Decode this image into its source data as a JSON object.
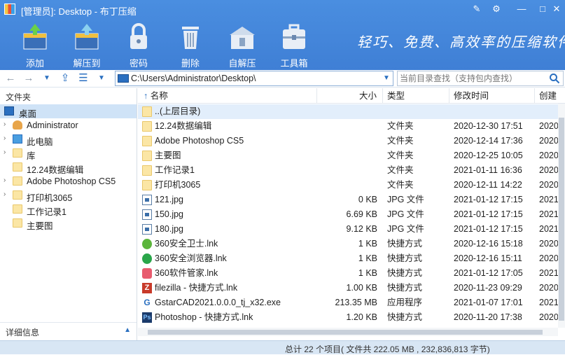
{
  "window": {
    "title": "[管理员]: Desktop - 布丁压缩"
  },
  "toolbar": {
    "tools": [
      {
        "label": "添加",
        "icon": "add-archive-icon"
      },
      {
        "label": "解压到",
        "icon": "extract-archive-icon"
      },
      {
        "label": "密码",
        "icon": "lock-icon"
      },
      {
        "label": "删除",
        "icon": "trash-icon"
      },
      {
        "label": "自解压",
        "icon": "self-extract-icon"
      },
      {
        "label": "工具箱",
        "icon": "toolbox-icon"
      }
    ],
    "slogan": "轻巧、免费、高效率的压缩软件"
  },
  "navigation": {
    "path": "C:\\Users\\Administrator\\Desktop\\",
    "search_placeholder": "当前目录查找（支持包内查找）"
  },
  "sidebar": {
    "header": "文件夹",
    "items": [
      {
        "label": "桌面",
        "selected": true,
        "expandable": false
      },
      {
        "label": "Administrator",
        "expandable": true
      },
      {
        "label": "此电脑",
        "expandable": true
      },
      {
        "label": "库",
        "expandable": true
      },
      {
        "label": "12.24数据编辑",
        "expandable": false
      },
      {
        "label": "Adobe Photoshop CS5",
        "expandable": true
      },
      {
        "label": "打印机3065",
        "expandable": true
      },
      {
        "label": "工作记录1",
        "expandable": false
      },
      {
        "label": "主要图",
        "expandable": false
      }
    ],
    "footer": "详细信息"
  },
  "file_list": {
    "columns": {
      "name": "名称",
      "size": "大小",
      "type": "类型",
      "modified": "修改时间",
      "created": "创建"
    },
    "rows": [
      {
        "name": "..(上层目录)",
        "size": "",
        "type": "",
        "modified": "",
        "created": "",
        "icon": "folder"
      },
      {
        "name": "12.24数据编辑",
        "size": "",
        "type": "文件夹",
        "modified": "2020-12-30 17:51",
        "created": "2020",
        "icon": "folder"
      },
      {
        "name": "Adobe Photoshop CS5",
        "size": "",
        "type": "文件夹",
        "modified": "2020-12-14 17:36",
        "created": "2020",
        "icon": "folder"
      },
      {
        "name": "主要图",
        "size": "",
        "type": "文件夹",
        "modified": "2020-12-25 10:05",
        "created": "2020",
        "icon": "folder"
      },
      {
        "name": "工作记录1",
        "size": "",
        "type": "文件夹",
        "modified": "2021-01-11 16:36",
        "created": "2020",
        "icon": "folder"
      },
      {
        "name": "打印机3065",
        "size": "",
        "type": "文件夹",
        "modified": "2020-12-11 14:22",
        "created": "2020",
        "icon": "folder"
      },
      {
        "name": "121.jpg",
        "size": "0 KB",
        "type": "JPG 文件",
        "modified": "2021-01-12 17:15",
        "created": "2021",
        "icon": "doc"
      },
      {
        "name": "150.jpg",
        "size": "6.69 KB",
        "type": "JPG 文件",
        "modified": "2021-01-12 17:15",
        "created": "2021",
        "icon": "doc"
      },
      {
        "name": "180.jpg",
        "size": "9.12 KB",
        "type": "JPG 文件",
        "modified": "2021-01-12 17:15",
        "created": "2021",
        "icon": "doc"
      },
      {
        "name": "360安全卫士.lnk",
        "size": "1 KB",
        "type": "快捷方式",
        "modified": "2020-12-16 15:18",
        "created": "2020",
        "icon": "lnk-green"
      },
      {
        "name": "360安全浏览器.lnk",
        "size": "1 KB",
        "type": "快捷方式",
        "modified": "2020-12-16 15:11",
        "created": "2020",
        "icon": "lnk-360"
      },
      {
        "name": "360软件管家.lnk",
        "size": "1 KB",
        "type": "快捷方式",
        "modified": "2021-01-12 17:05",
        "created": "2021",
        "icon": "lnk-pink"
      },
      {
        "name": "filezilla - 快捷方式.lnk",
        "size": "1.00 KB",
        "type": "快捷方式",
        "modified": "2020-11-23 09:29",
        "created": "2020",
        "icon": "lnk-fz"
      },
      {
        "name": "GstarCAD2021.0.0.0_tj_x32.exe",
        "size": "213.35 MB",
        "type": "应用程序",
        "modified": "2021-01-07 17:01",
        "created": "2021",
        "icon": "exe"
      },
      {
        "name": "Photoshop - 快捷方式.lnk",
        "size": "1.20 KB",
        "type": "快捷方式",
        "modified": "2020-11-20 17:38",
        "created": "2020",
        "icon": "lnk-ps"
      }
    ]
  },
  "status": {
    "text": "总计 22 个项目( 文件共 222.05 MB , 232,836,813 字节)"
  },
  "colors": {
    "accent": "#3f7fd5",
    "selection": "#cfe3f7",
    "folder": "#fbe6a5"
  }
}
